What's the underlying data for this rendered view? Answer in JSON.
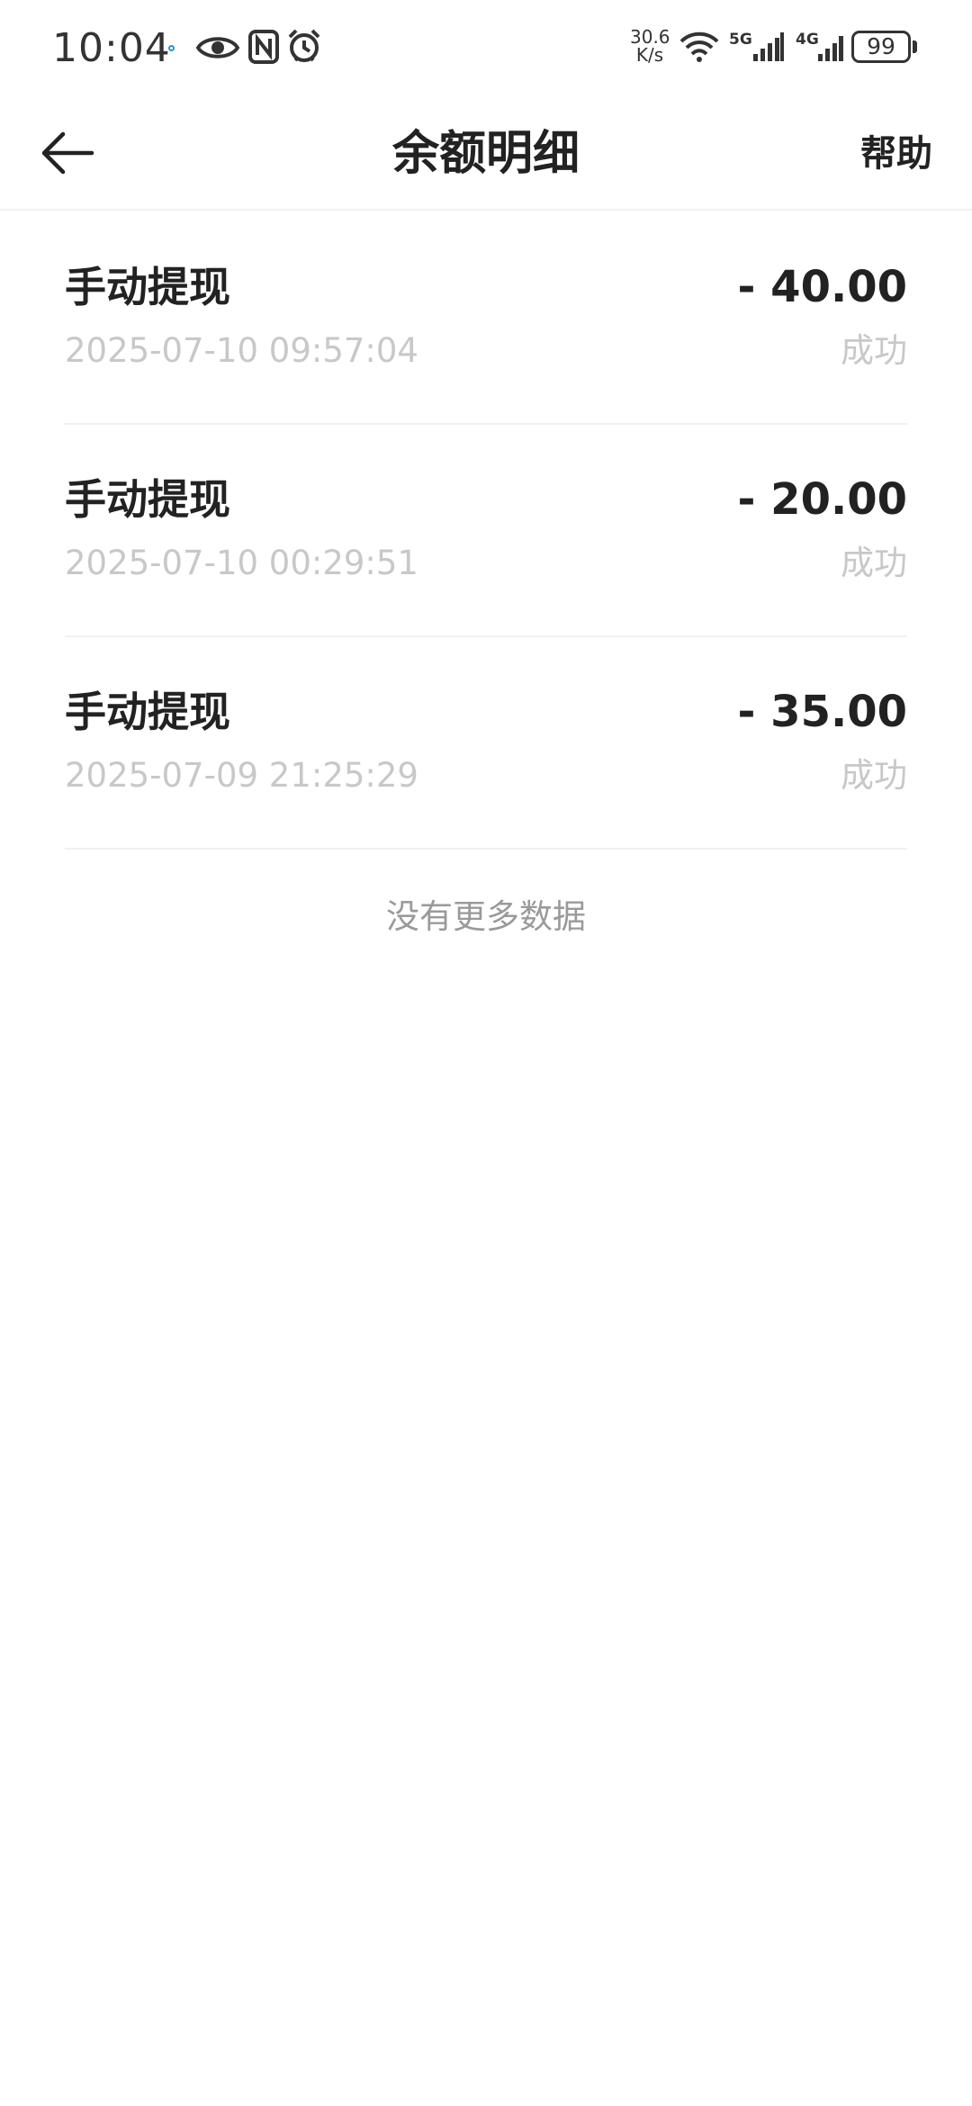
{
  "status_bar": {
    "time": "10:04",
    "net_speed_value": "30.6",
    "net_speed_unit": "K/s",
    "network_primary": "5G",
    "network_secondary": "4G",
    "battery": "99",
    "icons": [
      "eye-icon",
      "nfc-icon",
      "alarm-icon",
      "wifi-icon",
      "signal-icon",
      "battery-icon"
    ]
  },
  "header": {
    "title": "余额明细",
    "help_label": "帮助",
    "back_icon": "arrow-left-icon"
  },
  "transactions": [
    {
      "title": "手动提现",
      "time": "2025-07-10 09:57:04",
      "amount": "- 40.00",
      "status": "成功"
    },
    {
      "title": "手动提现",
      "time": "2025-07-10 00:29:51",
      "amount": "- 20.00",
      "status": "成功"
    },
    {
      "title": "手动提现",
      "time": "2025-07-09 21:25:29",
      "amount": "- 35.00",
      "status": "成功"
    }
  ],
  "footer": {
    "no_more_text": "没有更多数据"
  }
}
